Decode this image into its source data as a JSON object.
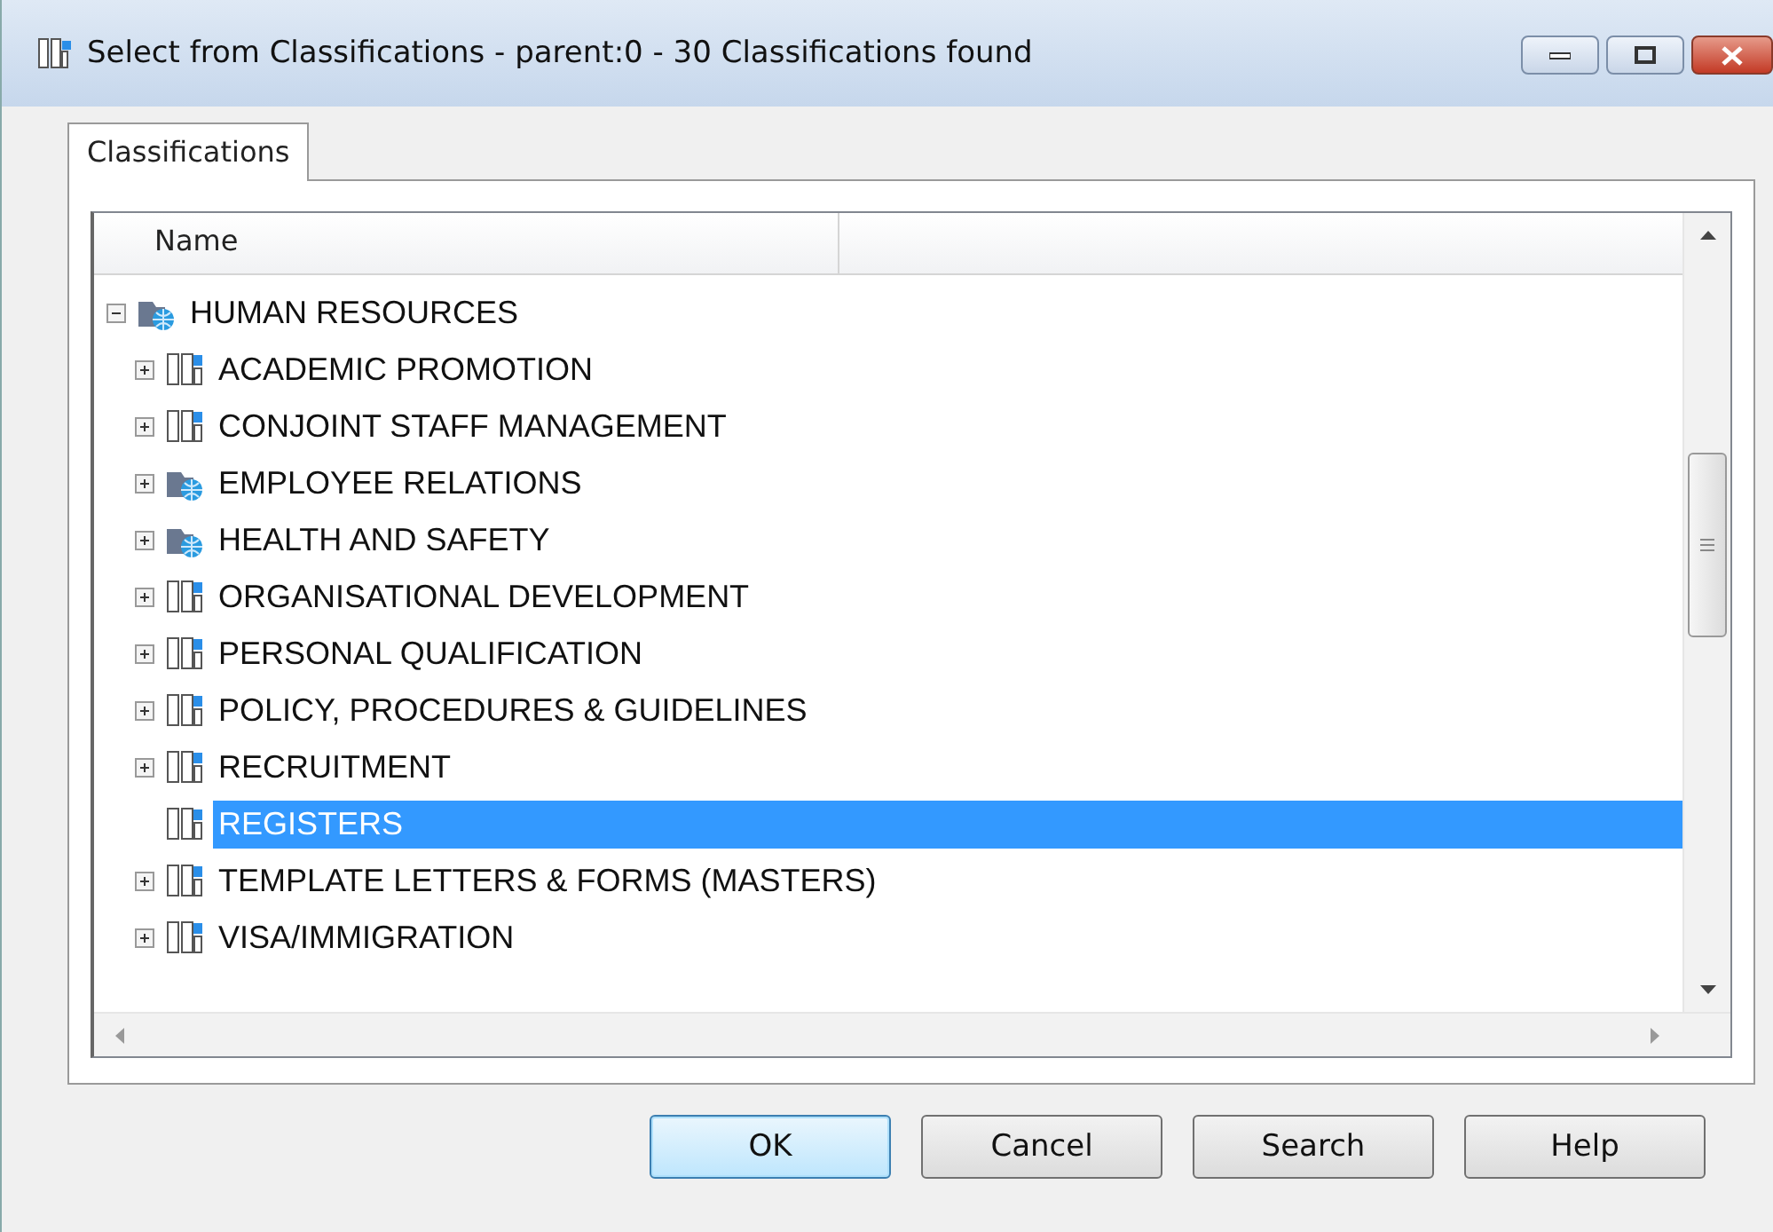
{
  "window": {
    "title": "Select from Classifications - parent:0 - 30 Classifications found"
  },
  "tabs": [
    {
      "label": "Classifications",
      "selected": true
    }
  ],
  "tree": {
    "columns": [
      "Name"
    ],
    "items": [
      {
        "label": "HUMAN RESOURCES",
        "kind": "folder",
        "expanded": true,
        "selected": false,
        "children": [
          {
            "label": "ACADEMIC PROMOTION",
            "kind": "binder",
            "expanded": false,
            "selected": false
          },
          {
            "label": "CONJOINT STAFF MANAGEMENT",
            "kind": "binder",
            "expanded": false,
            "selected": false
          },
          {
            "label": "EMPLOYEE RELATIONS",
            "kind": "folder",
            "expanded": false,
            "selected": false
          },
          {
            "label": "HEALTH AND SAFETY",
            "kind": "folder",
            "expanded": false,
            "selected": false
          },
          {
            "label": "ORGANISATIONAL DEVELOPMENT",
            "kind": "binder",
            "expanded": false,
            "selected": false
          },
          {
            "label": "PERSONAL QUALIFICATION",
            "kind": "binder",
            "expanded": false,
            "selected": false
          },
          {
            "label": "POLICY, PROCEDURES & GUIDELINES",
            "kind": "binder",
            "expanded": false,
            "selected": false
          },
          {
            "label": "RECRUITMENT",
            "kind": "binder",
            "expanded": false,
            "selected": false
          },
          {
            "label": "REGISTERS",
            "kind": "binder",
            "selected": true
          },
          {
            "label": "TEMPLATE LETTERS & FORMS (MASTERS)",
            "kind": "binder",
            "expanded": false,
            "selected": false
          },
          {
            "label": "VISA/IMMIGRATION",
            "kind": "binder",
            "expanded": false,
            "selected": false
          }
        ]
      }
    ]
  },
  "buttons": [
    {
      "label": "OK",
      "focused": true
    },
    {
      "label": "Cancel",
      "focused": false
    },
    {
      "label": "Search",
      "focused": false
    },
    {
      "label": "Help",
      "focused": false
    }
  ]
}
